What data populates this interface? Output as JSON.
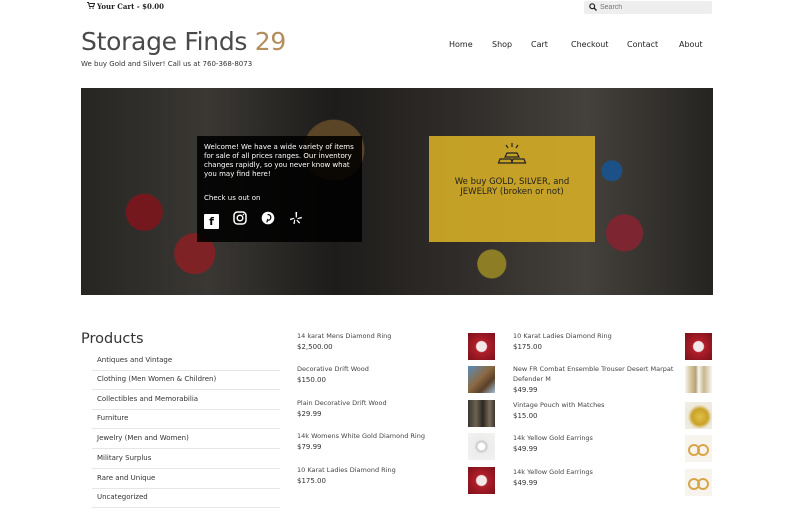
{
  "topbar": {
    "cart_label": "Your Cart - $0.00",
    "cart_icon": "cart-icon",
    "search_icon": "search-icon",
    "search_placeholder": "Search"
  },
  "site": {
    "title": "Storage Finds",
    "title_num": "29",
    "tagline": "We buy Gold and Silver! Call us at 760-368-8073"
  },
  "nav": [
    "Home",
    "Shop",
    "Cart",
    "Checkout",
    "Contact",
    "About"
  ],
  "hero": {
    "welcome_text": "Welcome! We have a wide variety of items for sale of all prices ranges. Our inventory changes rapidly, so you never know what you may find here!",
    "check_text": "Check us out on",
    "socials": [
      "facebook-icon",
      "instagram-icon",
      "pinterest-icon",
      "yelp-icon"
    ],
    "gold_text": "We buy GOLD, SILVER, and JEWELRY (broken or not)",
    "gold_icon": "gold-bars-icon"
  },
  "products_title": "Products",
  "categories": [
    "Antiques and Vintage",
    "Clothing (Men Women & Children)",
    "Collectibles and Memorabilia",
    "Furniture",
    "Jewelry (Men and Women)",
    "Military Surplus",
    "Rare and Unique",
    "Uncategorized"
  ],
  "products_left": [
    {
      "name": "14 karat Mens Diamond Ring",
      "price": "$2,500.00"
    },
    {
      "name": "Decorative Drift Wood",
      "price": "$150.00"
    },
    {
      "name": "Plain Decorative Drift Wood",
      "price": "$29.99"
    },
    {
      "name": "14k Womens White Gold Diamond Ring",
      "price": "$79.99"
    },
    {
      "name": "10 Karat Ladies Diamond Ring",
      "price": "$175.00"
    }
  ],
  "products_right": [
    {
      "name": "10 Karat Ladies Diamond Ring",
      "price": "$175.00"
    },
    {
      "name": "New FR Combat Ensemble Trouser Desert Marpat Defender M",
      "price": "$49.99"
    },
    {
      "name": "Vintage Pouch with Matches",
      "price": "$15.00"
    },
    {
      "name": "14k Yellow Gold Earrings",
      "price": "$49.99"
    },
    {
      "name": "14k Yellow Gold Earrings",
      "price": "$49.99"
    }
  ]
}
